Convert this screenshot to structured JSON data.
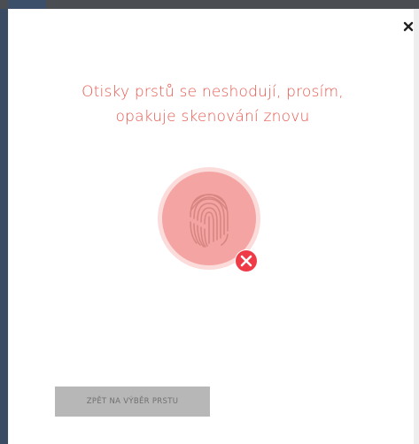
{
  "dialog": {
    "message_line1": "Otisky prstů se neshodují, prosím,",
    "message_line2": "opakuje skenování znovu",
    "back_button_label": "ZPĚT NA VÝBĚR PRSTU"
  },
  "icons": {
    "close": "close-icon",
    "fingerprint": "fingerprint-icon",
    "error": "error-x-icon"
  },
  "colors": {
    "accent_error": "#e8584e",
    "error_badge": "#ee3b47",
    "scanner_fill": "#f4a5a3",
    "scanner_ring": "#fbdcda",
    "button_bg": "#b7b7b7",
    "button_text": "#6f6f6f"
  },
  "state": {
    "match_status": "mismatch"
  }
}
